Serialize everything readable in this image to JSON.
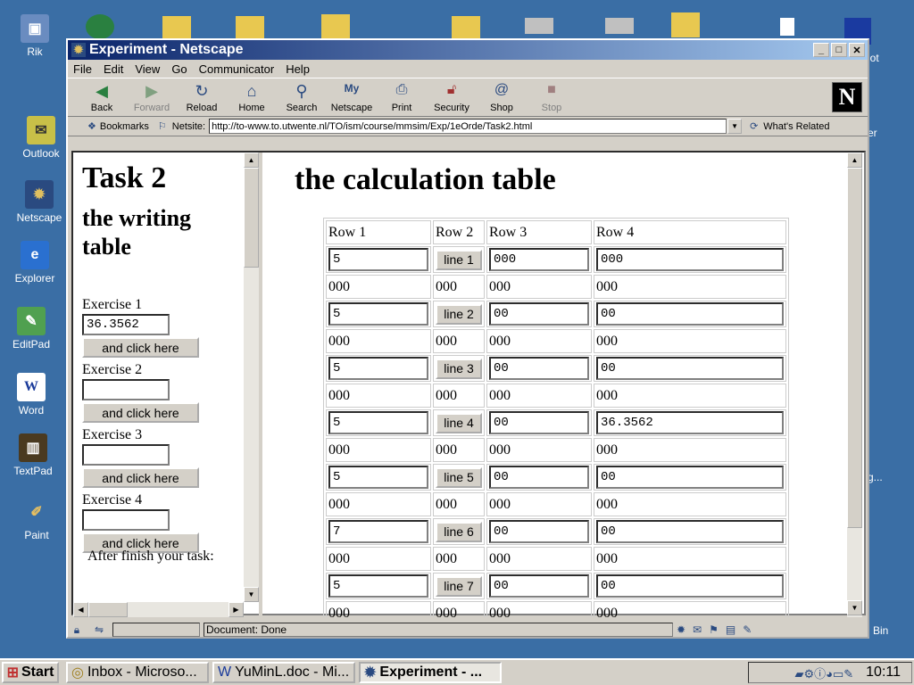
{
  "desktop": {
    "icons": [
      {
        "label": "Rik",
        "icon": "computer-icon"
      },
      {
        "label": "Outlook",
        "icon": "outlook-icon"
      },
      {
        "label": "Netscape",
        "icon": "netscape-icon"
      },
      {
        "label": "Explorer",
        "icon": "ie-icon"
      },
      {
        "label": "EditPad",
        "icon": "editpad-icon"
      },
      {
        "label": "Word",
        "icon": "word-icon"
      },
      {
        "label": "TextPad",
        "icon": "textpad-icon"
      },
      {
        "label": "Paint",
        "icon": "paint-icon"
      }
    ],
    "right_labels": {
      "lot": "lot",
      "er": "er",
      "dots": "g...",
      "bin": "Bin"
    }
  },
  "window": {
    "title": "Experiment - Netscape",
    "menu": [
      "File",
      "Edit",
      "View",
      "Go",
      "Communicator",
      "Help"
    ],
    "toolbar": [
      {
        "label": "Back",
        "disabled": false
      },
      {
        "label": "Forward",
        "disabled": true
      },
      {
        "label": "Reload",
        "disabled": false
      },
      {
        "label": "Home",
        "disabled": false
      },
      {
        "label": "Search",
        "disabled": false
      },
      {
        "label": "Netscape",
        "disabled": false
      },
      {
        "label": "Print",
        "disabled": false
      },
      {
        "label": "Security",
        "disabled": false
      },
      {
        "label": "Shop",
        "disabled": false
      },
      {
        "label": "Stop",
        "disabled": true
      }
    ],
    "location": {
      "bookmarks_label": "Bookmarks",
      "netsite_label": "Netsite:",
      "url": "http://to-www.to.utwente.nl/TO/ism/course/mmsim/Exp/1eOrde/Task2.html",
      "related_label": "What's Related"
    },
    "status": "Document: Done"
  },
  "left_frame": {
    "heading": "Task 2",
    "subheading": "the writing table",
    "exercises": [
      {
        "label": "Exercise 1",
        "value": "36.3562",
        "button": "and click here"
      },
      {
        "label": "Exercise 2",
        "value": "",
        "button": "and click here"
      },
      {
        "label": "Exercise 3",
        "value": "",
        "button": "and click here"
      },
      {
        "label": "Exercise 4",
        "value": "",
        "button": "and click here"
      }
    ],
    "footer": "After finish your task:"
  },
  "right_frame": {
    "heading": "the calculation table",
    "columns": [
      "Row 1",
      "Row 2",
      "Row 3",
      "Row 4"
    ],
    "rows": [
      {
        "input1": "5",
        "button": "line 1",
        "input3": "000",
        "input4": "000",
        "out": [
          "000",
          "000",
          "000",
          "000"
        ]
      },
      {
        "input1": "5",
        "button": "line 2",
        "input3": "00",
        "input4": "00",
        "out": [
          "000",
          "000",
          "000",
          "000"
        ]
      },
      {
        "input1": "5",
        "button": "line 3",
        "input3": "00",
        "input4": "00",
        "out": [
          "000",
          "000",
          "000",
          "000"
        ]
      },
      {
        "input1": "5",
        "button": "line 4",
        "input3": "00",
        "input4": "36.3562",
        "out": [
          "000",
          "000",
          "000",
          "000"
        ]
      },
      {
        "input1": "5",
        "button": "line 5",
        "input3": "00",
        "input4": "00",
        "out": [
          "000",
          "000",
          "000",
          "000"
        ]
      },
      {
        "input1": "7",
        "button": "line 6",
        "input3": "00",
        "input4": "00",
        "out": [
          "000",
          "000",
          "000",
          "000"
        ]
      },
      {
        "input1": "5",
        "button": "line 7",
        "input3": "00",
        "input4": "00",
        "out": [
          "000",
          "000",
          "000",
          "000"
        ]
      }
    ]
  },
  "taskbar": {
    "start": "Start",
    "tasks": [
      {
        "label": "Inbox - Microso...",
        "active": false
      },
      {
        "label": "YuMinL.doc - Mi...",
        "active": false
      },
      {
        "label": "Experiment - ...",
        "active": true
      }
    ],
    "clock": "10:11"
  },
  "colors": {
    "desktop": "#3a6ea5",
    "titlebar": "#0a246a",
    "chrome": "#d4d0c8"
  }
}
